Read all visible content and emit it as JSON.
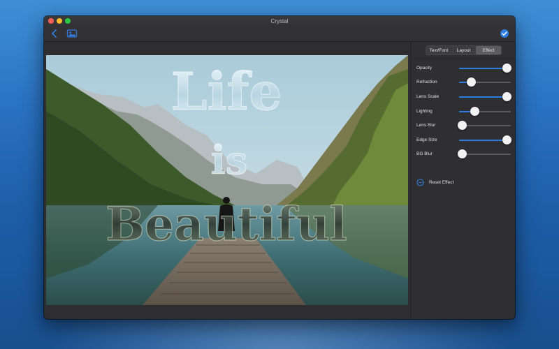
{
  "window": {
    "title": "Crystal"
  },
  "toolbar": {
    "back_icon": "chevron-left-icon",
    "photo_icon": "photo-icon",
    "done_icon": "checkmark-circle-icon",
    "accent": "#2f7de0"
  },
  "tabs": [
    {
      "label": "Text/Font",
      "active": false
    },
    {
      "label": "Layout",
      "active": false
    },
    {
      "label": "Effect",
      "active": true
    }
  ],
  "controls": [
    {
      "label": "Opacity",
      "value": 1.0
    },
    {
      "label": "Refraction",
      "value": 0.23
    },
    {
      "label": "Lens Scale",
      "value": 1.0
    },
    {
      "label": "Lighting",
      "value": 0.31
    },
    {
      "label": "Lens Blur",
      "value": 0.0
    },
    {
      "label": "Edge Size",
      "value": 1.0
    },
    {
      "label": "BG Blur",
      "value": 0.0
    }
  ],
  "reset": {
    "label": "Reset Effect",
    "icon": "reset-circle-icon"
  },
  "canvas": {
    "words": [
      "Life",
      "is",
      "Beautiful"
    ]
  }
}
